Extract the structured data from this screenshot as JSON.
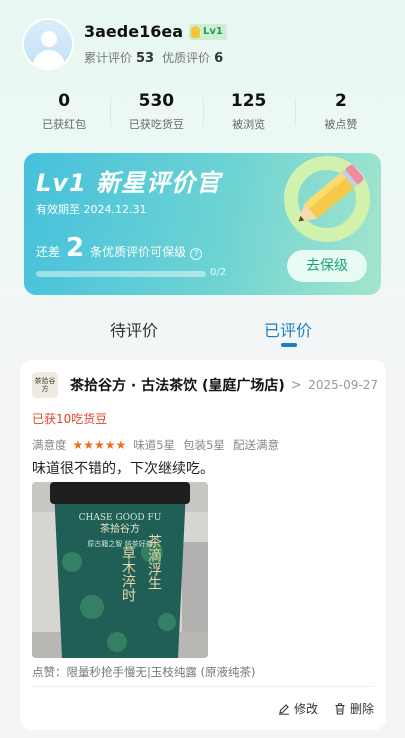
{
  "profile": {
    "username": "3aede16ea",
    "level_badge": "Lv1",
    "total_reviews_label": "累计评价",
    "total_reviews": "53",
    "quality_reviews_label": "优质评价",
    "quality_reviews": "6"
  },
  "counters": [
    {
      "num": "0",
      "label": "已获红包"
    },
    {
      "num": "530",
      "label": "已获吃货豆"
    },
    {
      "num": "125",
      "label": "被浏览"
    },
    {
      "num": "2",
      "label": "被点赞"
    }
  ],
  "level_card": {
    "title": "Lv1 新星评价官",
    "valid_until": "有效期至 2024.12.31",
    "hint_prefix": "还差",
    "hint_count": "2",
    "hint_suffix": "条优质评价可保级",
    "help_icon": "?",
    "progress_text": "0/2",
    "progress": 0,
    "keep_button": "去保级"
  },
  "tabs": [
    {
      "label": "待评价",
      "active": false
    },
    {
      "label": "已评价",
      "active": true
    }
  ],
  "review": {
    "shop_logo_text": "茶拾谷方",
    "shop_name": "茶拾谷方 · 古法茶饮 (皇庭广场店)",
    "chevron": ">",
    "date": "2025-09-27",
    "reward": "已获10吃货豆",
    "satisfaction_label": "满意度",
    "stars": "★★★★★",
    "taste": "味道5星",
    "packaging": "包装5星",
    "delivery": "配送满意",
    "text": "味道很不错的，下次继续吃。",
    "cup_text_top": "CHASE GOOD FU",
    "cup_brand": "茶拾谷方",
    "cup_line": "原古籍之智 焙茶好茶",
    "cup_right": "茶滴浮生",
    "cup_left": "草木淬时",
    "liked": "点赞：限量秒抢手慢无|玉枝纯露 (原液纯茶)",
    "edit": "修改",
    "delete": "删除"
  },
  "colors": {
    "accent_blue": "#1a7fc8",
    "reward_red": "#e0452b",
    "star_orange": "#f46b1b",
    "level_green": "#1aa37a"
  }
}
